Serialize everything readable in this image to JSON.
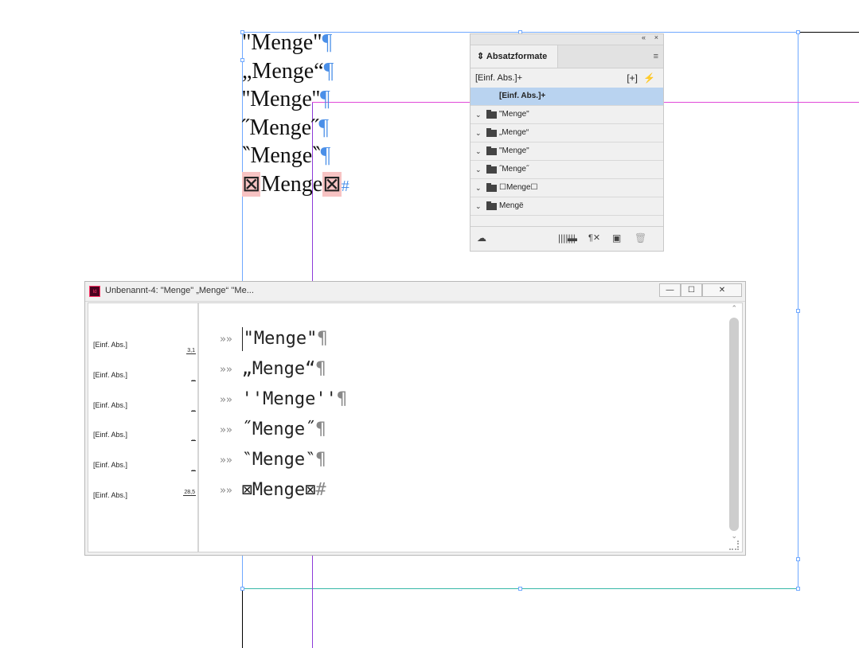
{
  "layout": {
    "lines": [
      {
        "text": "\"Menge\"",
        "mark": "¶"
      },
      {
        "text": "„Menge“",
        "mark": "¶"
      },
      {
        "text": "''Menge''",
        "mark": "¶"
      },
      {
        "text": "˝Menge˝",
        "mark": "¶"
      },
      {
        "text": "‶Menge‶",
        "mark": "¶"
      },
      {
        "pre": "⊠",
        "text": "Menge",
        "post": "⊠",
        "mark": "#"
      }
    ]
  },
  "panel": {
    "title": "Absatzformate",
    "collapse_icon": "«",
    "close_icon": "×",
    "menu_icon": "≡",
    "current_style": "[Einf. Abs.]+",
    "new_from_selection_icon": "[+]",
    "quick_apply_icon": "⚡",
    "selected_style": "[Einf. Abs.]+",
    "groups": [
      {
        "label": "\"Menge\""
      },
      {
        "label": "„Menge“"
      },
      {
        "label": "\"Menge\""
      },
      {
        "label": "˝Menge˝"
      },
      {
        "label": "☐Menge☐"
      },
      {
        "label": "Mengë"
      }
    ],
    "footer": {
      "cloud_icon": "☁",
      "folder_icon": "▬",
      "clear_icon": "¶✕",
      "new_icon": "▣",
      "trash_icon": "🗑"
    },
    "grip": "|||||||"
  },
  "editor": {
    "title": "Unbenannt-4: \"Menge\" „Menge“ ''Me...",
    "app_icon_text": "Id",
    "buttons": {
      "minimize": "—",
      "maximize": "☐",
      "close": "✕"
    },
    "rows": [
      {
        "style": "[Einf. Abs.]",
        "depth": "3,1",
        "text": "\"Menge\"",
        "mark": "¶"
      },
      {
        "style": "[Einf. Abs.]",
        "depth": "_",
        "text": "„Menge“",
        "mark": "¶"
      },
      {
        "style": "[Einf. Abs.]",
        "depth": "_",
        "text": "''Menge''",
        "mark": "¶"
      },
      {
        "style": "[Einf. Abs.]",
        "depth": "_",
        "text": "˝Menge˝",
        "mark": "¶"
      },
      {
        "style": "[Einf. Abs.]",
        "depth": "_",
        "text": "‶Menge‶",
        "mark": "¶"
      },
      {
        "style": "[Einf. Abs.]",
        "depth": "28,5",
        "text": "⊠Menge⊠",
        "mark": "#"
      }
    ],
    "arrow": "»»"
  }
}
